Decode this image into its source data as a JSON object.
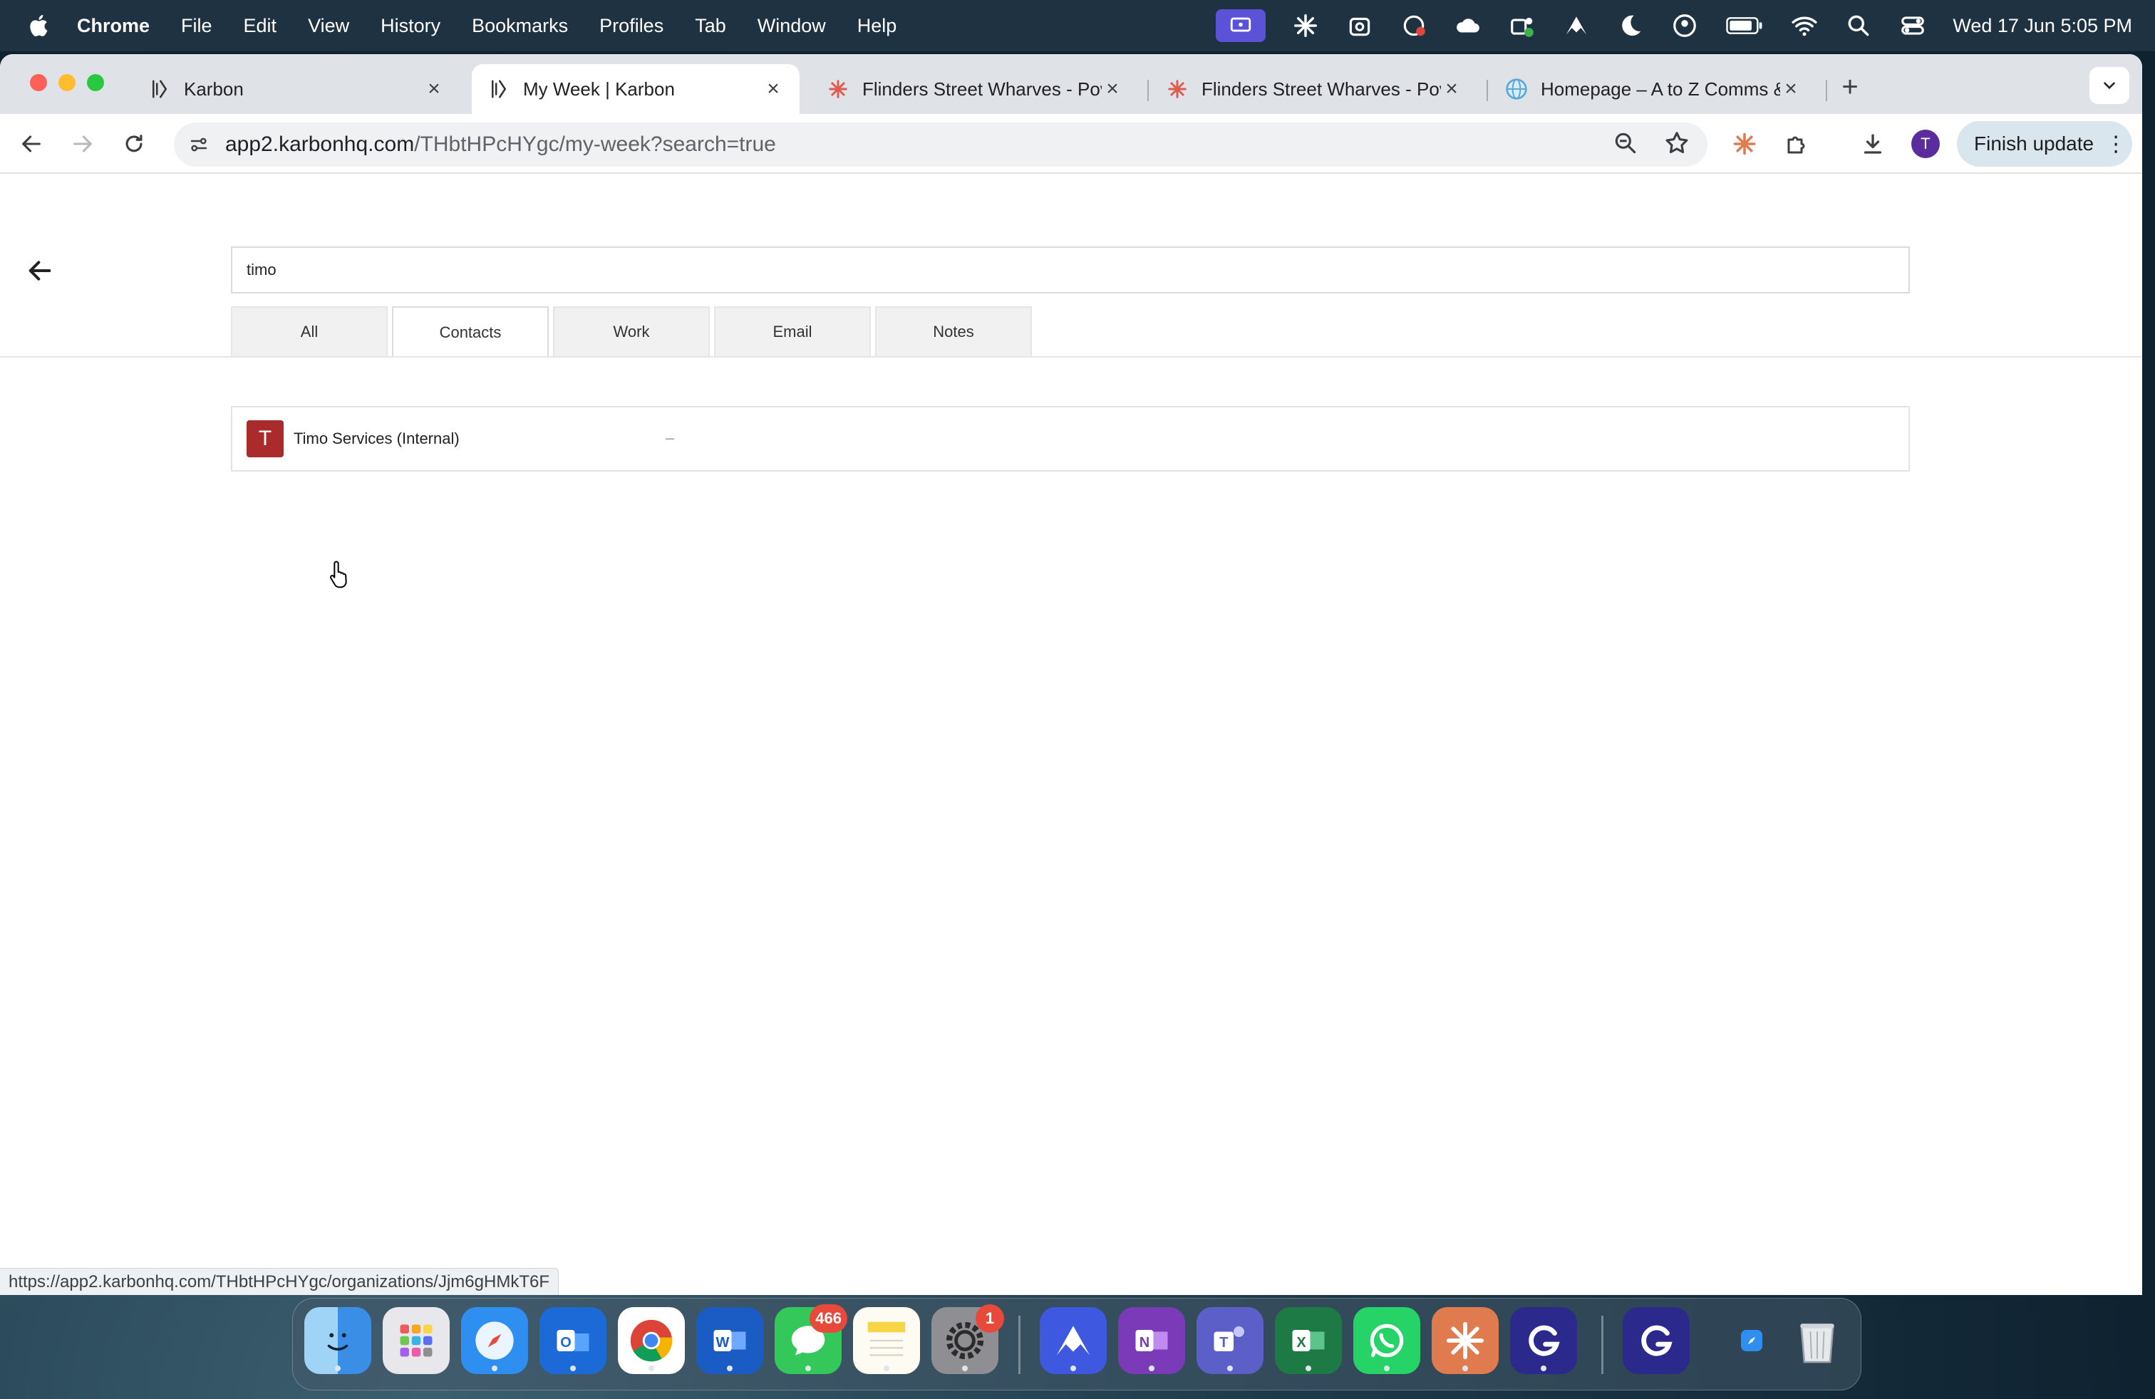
{
  "menubar": {
    "app_name": "Chrome",
    "items": [
      "File",
      "Edit",
      "View",
      "History",
      "Bookmarks",
      "Profiles",
      "Tab",
      "Window",
      "Help"
    ],
    "clock": "Wed 17 Jun  5:05 PM"
  },
  "browser": {
    "tabs": [
      {
        "title": "Karbon",
        "favicon": "karbon-icon"
      },
      {
        "title": "My Week | Karbon",
        "favicon": "karbon-icon",
        "active": true
      },
      {
        "title": "Flinders Street Wharves - Pov",
        "favicon": "pinwheel-icon"
      },
      {
        "title": "Flinders Street Wharves - Pov",
        "favicon": "pinwheel-icon"
      },
      {
        "title": "Homepage – A to Z Comms &",
        "favicon": "globe-icon"
      }
    ],
    "url_host": "app2.karbonhq.com",
    "url_path": "/THbtHPcHYgc/my-week?search=true",
    "profile_initial": "T",
    "finish_update_label": "Finish update",
    "status_url": "https://app2.karbonhq.com/THbtHPcHYgc/organizations/Jjm6gHMkT6F"
  },
  "search": {
    "query": "timo",
    "tabs": [
      "All",
      "Contacts",
      "Work",
      "Email",
      "Notes"
    ],
    "active_tab": "Contacts",
    "results": [
      {
        "avatar_letter": "T",
        "name": "Timo Services (Internal)",
        "detail": "–"
      }
    ]
  },
  "dock": {
    "messages_badge": "466",
    "settings_badge": "1"
  },
  "colors": {
    "menubar_bg": "#1e3242",
    "tabstrip_bg": "#dfe3e8",
    "result_avatar": "#a92b2b",
    "profile_avatar": "#5b2c9e"
  }
}
